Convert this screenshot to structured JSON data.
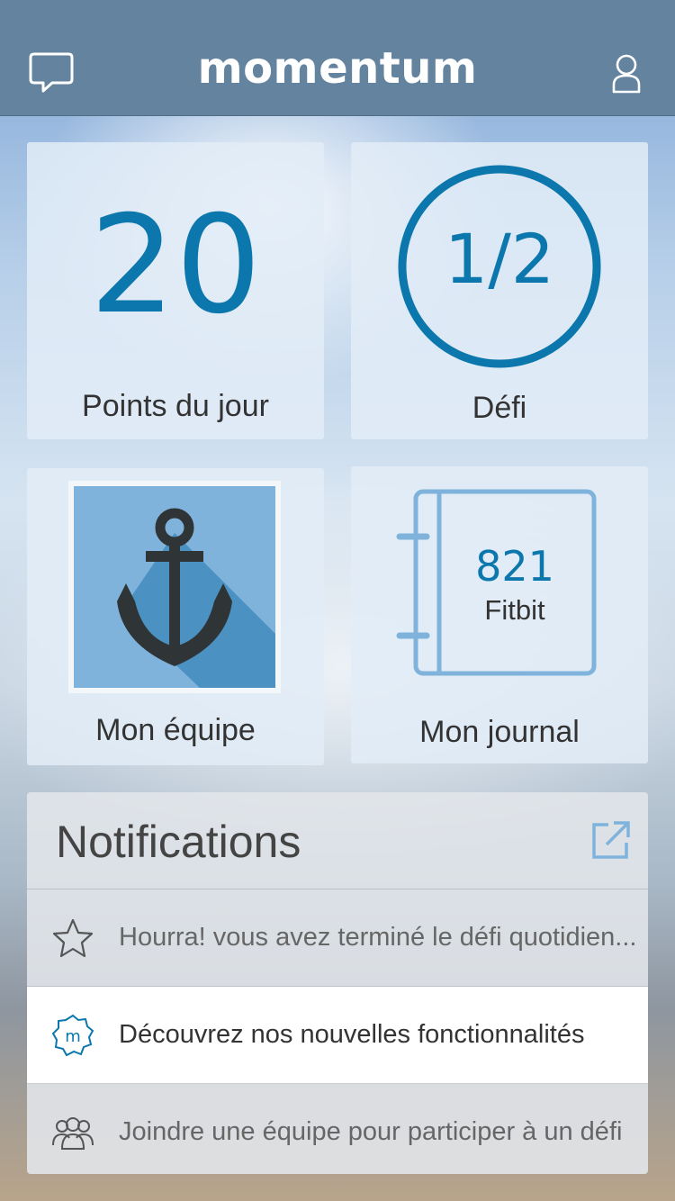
{
  "app": {
    "title": "momentum"
  },
  "header": {
    "chat_icon": "chat-bubble-icon",
    "profile_icon": "user-icon"
  },
  "tiles": {
    "points": {
      "value": "20",
      "label": "Points du jour"
    },
    "challenge": {
      "value": "1/2",
      "label": "Défi",
      "progress": 0.5
    },
    "team": {
      "label": "Mon équipe",
      "image_icon": "anchor-icon"
    },
    "journal": {
      "value": "821",
      "source": "Fitbit",
      "label": "Mon journal",
      "icon": "notebook-icon"
    }
  },
  "notifications": {
    "title": "Notifications",
    "open_icon": "external-link-icon",
    "items": [
      {
        "icon": "star-icon",
        "text": "Hourra! vous avez terminé le défi quotidien..."
      },
      {
        "icon": "momentum-badge-icon",
        "text": "Découvrez nos nouvelles fonctionnalités"
      },
      {
        "icon": "group-icon",
        "text": "Joindre une équipe pour participer à un défi"
      }
    ]
  },
  "colors": {
    "accent": "#0b77ac",
    "header": "#63839f"
  }
}
